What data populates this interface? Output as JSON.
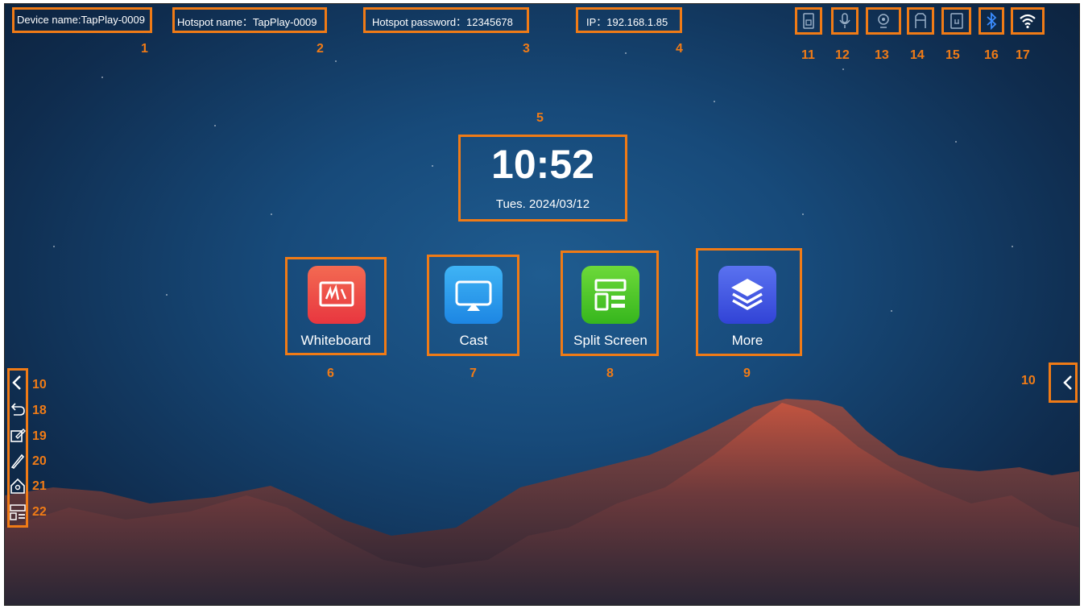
{
  "status_bar": {
    "device_name": "Device name:TapPlay-0009",
    "hotspot_name": "Hotspot name：TapPlay-0009",
    "hotspot_password": "Hotspot password：12345678",
    "ip": "IP：192.168.1.85",
    "icons": [
      "usb-drive-icon",
      "microphone-icon",
      "camera-icon",
      "hdmi-icon",
      "usb-icon",
      "bluetooth-icon",
      "wifi-icon"
    ]
  },
  "clock": {
    "time": "10:52",
    "date": "Tues. 2024/03/12"
  },
  "apps": [
    {
      "label": "Whiteboard",
      "icon": "whiteboard-icon",
      "color": "#ef4b4b"
    },
    {
      "label": "Cast",
      "icon": "cast-icon",
      "color": "#2d9bea"
    },
    {
      "label": "Split Screen",
      "icon": "split-screen-icon",
      "color": "#4fc625"
    },
    {
      "label": "More",
      "icon": "layers-icon",
      "color": "#4358e0"
    }
  ],
  "side_toolbar": {
    "icons": [
      "collapse-arrow-icon",
      "back-icon",
      "annotate-icon",
      "pen-icon",
      "home-icon",
      "split-screen-icon"
    ]
  },
  "callouts": {
    "n1": "1",
    "n2": "2",
    "n3": "3",
    "n4": "4",
    "n5": "5",
    "n6": "6",
    "n7": "7",
    "n8": "8",
    "n9": "9",
    "n10_left": "10",
    "n10_right": "10",
    "n11": "11",
    "n12": "12",
    "n13": "13",
    "n14": "14",
    "n15": "15",
    "n16": "16",
    "n17": "17",
    "n18": "18",
    "n19": "19",
    "n20": "20",
    "n21": "21",
    "n22": "22"
  },
  "colors": {
    "callout": "#f07b16",
    "bluetooth": "#3b8cff"
  }
}
